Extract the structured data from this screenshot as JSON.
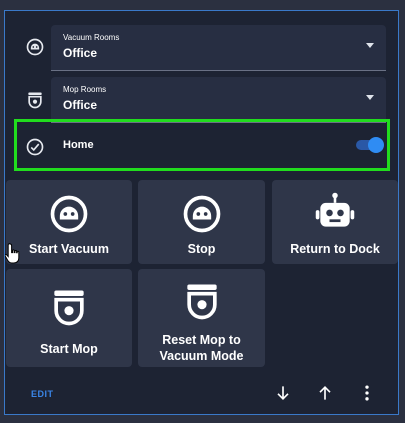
{
  "vacuum_rooms": {
    "label": "Vacuum Rooms",
    "value": "Office",
    "icon": "vacuum-robot-icon"
  },
  "mop_rooms": {
    "label": "Mop Rooms",
    "value": "Office",
    "icon": "mop-robot-icon"
  },
  "home": {
    "label": "Home",
    "toggle_on": true,
    "icon": "check-circle-icon"
  },
  "buttons": [
    {
      "label": "Start Vacuum",
      "icon": "vacuum-robot-icon"
    },
    {
      "label": "Stop",
      "icon": "vacuum-robot-icon"
    },
    {
      "label": "Return to Dock",
      "icon": "robot-head-icon"
    },
    {
      "label": "Start Mop",
      "icon": "mop-robot-icon"
    },
    {
      "label_line1": "Reset Mop to",
      "label_line2": "Vacuum Mode",
      "icon": "mop-robot-icon"
    }
  ],
  "footer": {
    "edit_label": "EDIT",
    "icons": [
      "arrow-down-icon",
      "arrow-up-icon",
      "more-vertical-icon"
    ]
  },
  "colors": {
    "highlight": "#21dc1e",
    "accent": "#2f8cf3",
    "card_border": "#3a79c9",
    "button_bg": "#2f3649",
    "card_bg": "#1d2333"
  }
}
